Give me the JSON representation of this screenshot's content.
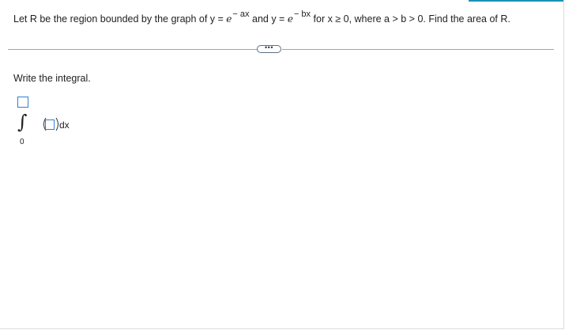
{
  "question": {
    "part1": "Let R be the region bounded by the graph of y = ",
    "e1": "e",
    "exp1": "− ax",
    "part2": " and y = ",
    "e2": "e",
    "exp2": "− bx",
    "part3": " for x ≥ 0, where a > b > 0. Find the area of R."
  },
  "expand_button": {
    "label": "•••"
  },
  "prompt": "Write the integral.",
  "integral": {
    "sign": "∫",
    "lower_limit": "0",
    "upper_limit_value": "",
    "integrand_value": "",
    "differential": "dx"
  },
  "colors": {
    "accent": "#1a93b8",
    "input_border": "#2f7fd6",
    "divider": "#9aa7b3"
  }
}
